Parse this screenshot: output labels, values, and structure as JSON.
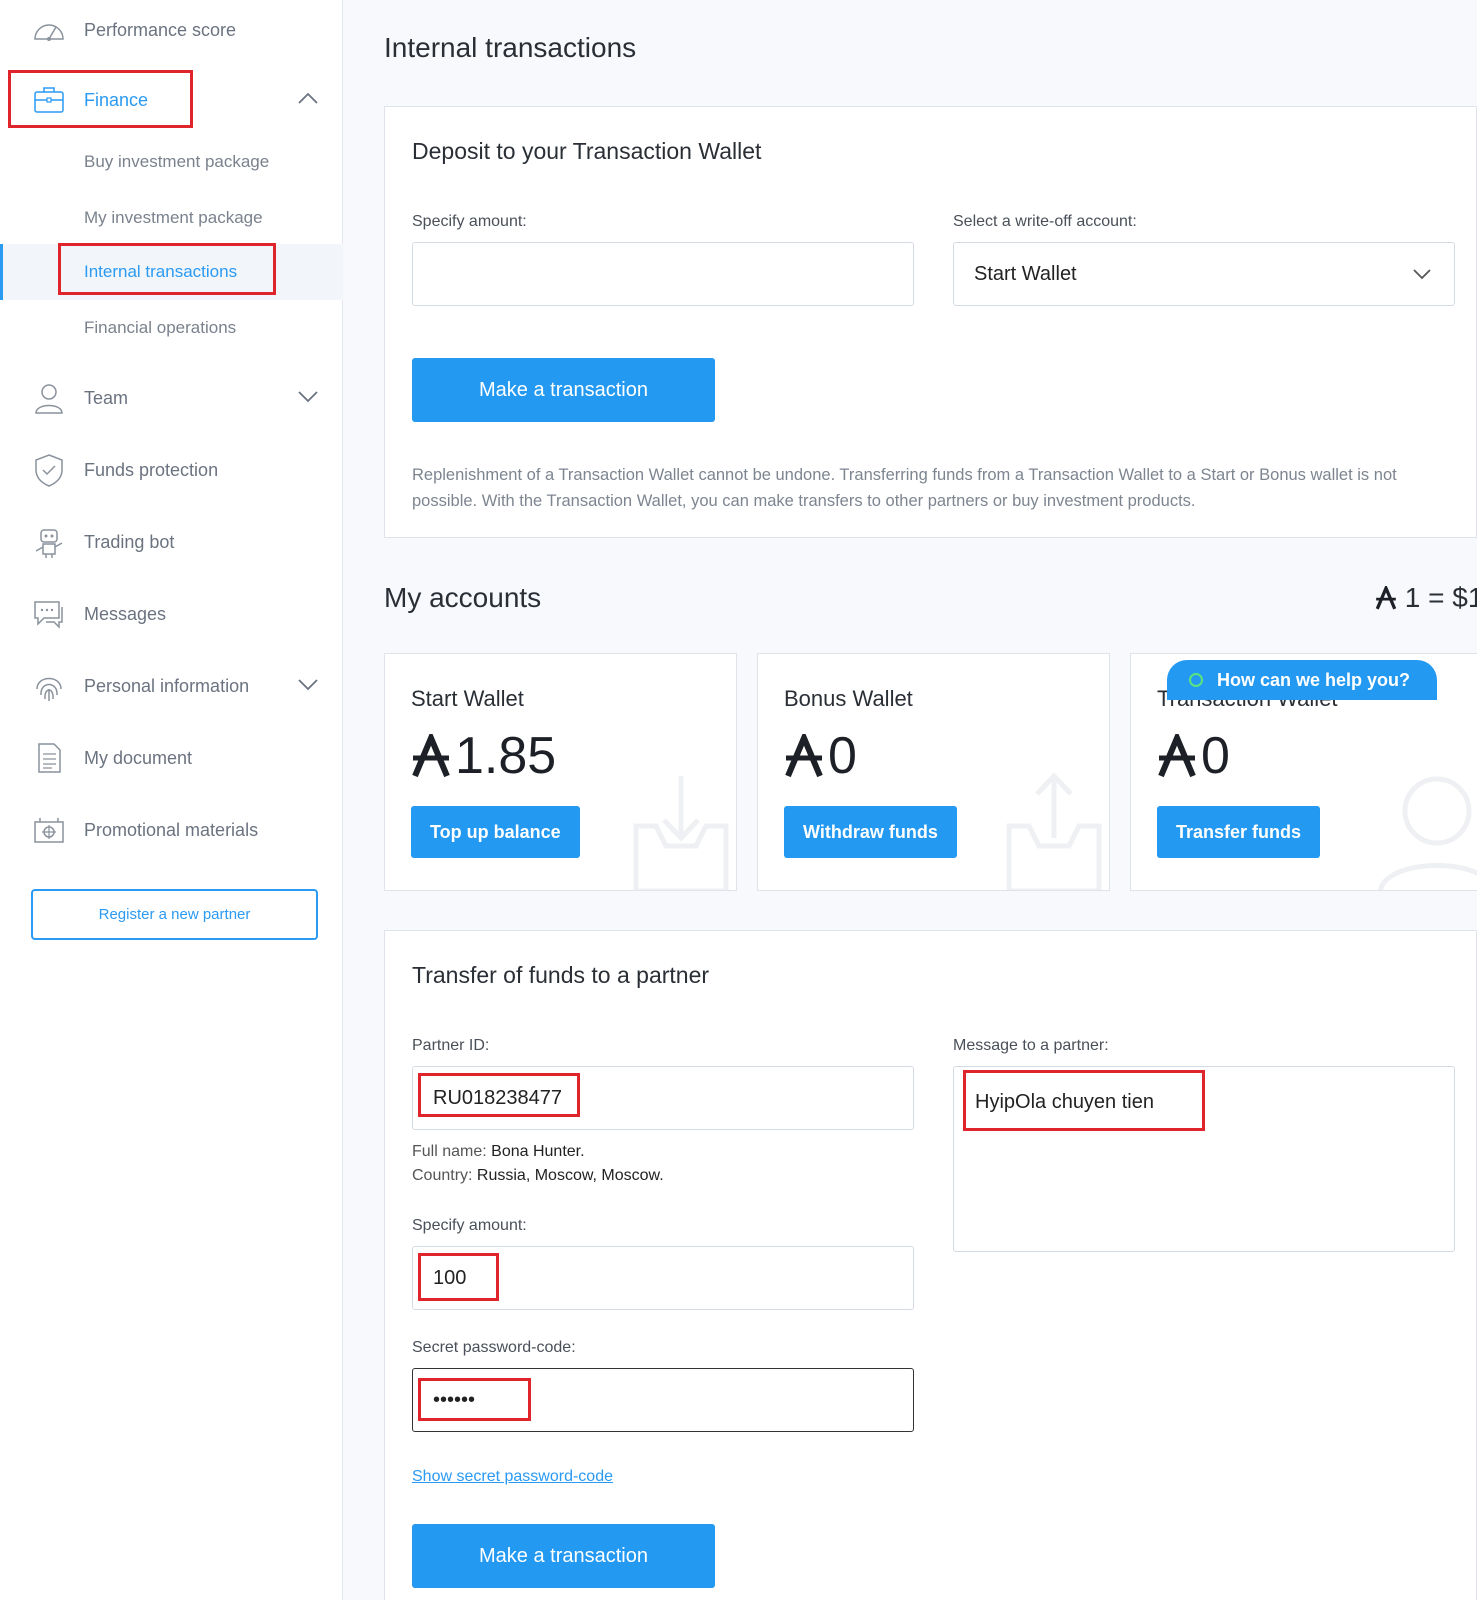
{
  "sidebar": {
    "items": [
      {
        "label": "Performance score",
        "icon": "gauge-icon"
      },
      {
        "label": "Finance",
        "icon": "briefcase-icon"
      },
      {
        "label": "Team",
        "icon": "user-icon"
      },
      {
        "label": "Funds protection",
        "icon": "shield-icon"
      },
      {
        "label": "Trading bot",
        "icon": "robot-icon"
      },
      {
        "label": "Messages",
        "icon": "chat-icon"
      },
      {
        "label": "Personal information",
        "icon": "fingerprint-icon"
      },
      {
        "label": "My document",
        "icon": "document-icon"
      },
      {
        "label": "Promotional materials",
        "icon": "promo-icon"
      }
    ],
    "finance_sub": [
      {
        "label": "Buy investment package"
      },
      {
        "label": "My investment package"
      },
      {
        "label": "Internal transactions"
      },
      {
        "label": "Financial operations"
      }
    ],
    "register_label": "Register a new partner"
  },
  "page": {
    "title": "Internal transactions"
  },
  "deposit": {
    "title": "Deposit to your Transaction Wallet",
    "amount_label": "Specify amount:",
    "amount_value": "",
    "account_label": "Select a write-off account:",
    "account_selected": "Start Wallet",
    "button": "Make a transaction",
    "note": "Replenishment of a Transaction Wallet cannot be undone. Transferring funds from a Transaction Wallet to a Start or Bonus wallet is not possible. With the Transaction Wallet, you can make transfers to other partners or buy investment products."
  },
  "accounts": {
    "title": "My accounts",
    "rate_left": "1",
    "rate_right": "= $1",
    "wallets": [
      {
        "title": "Start Wallet",
        "amount": "1.85",
        "button": "Top up balance"
      },
      {
        "title": "Bonus Wallet",
        "amount": "0",
        "button": "Withdraw funds"
      },
      {
        "title": "Transaction Wallet",
        "amount": "0",
        "button": "Transfer funds"
      }
    ],
    "chat": "How can we help you?"
  },
  "transfer": {
    "title": "Transfer of funds to a partner",
    "partner_id_label": "Partner ID:",
    "partner_id_value": "RU018238477",
    "fullname_label": "Full name:",
    "fullname_value": "Bona Hunter.",
    "country_label": "Country:",
    "country_value": "Russia, Moscow, Moscow.",
    "amount_label": "Specify amount:",
    "amount_value": "100",
    "password_label": "Secret password-code:",
    "password_value": "••••••",
    "show_password": "Show secret password-code",
    "message_label": "Message to a partner:",
    "message_value": "HyipOla chuyen tien",
    "button": "Make a transaction"
  },
  "colors": {
    "accent": "#2399f1",
    "highlight_box": "#e0242b"
  }
}
